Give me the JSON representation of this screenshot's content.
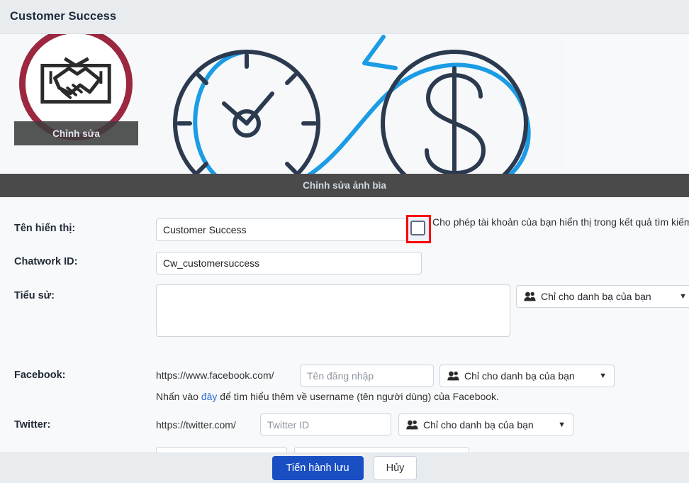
{
  "header": {
    "title": "Customer Success"
  },
  "cover": {
    "edit_label": "Chỉnh sửa ảnh bìa",
    "image_alt": "clock-infinity-dollar-illustration"
  },
  "avatar": {
    "edit_label": "Chỉnh sửa",
    "image_alt": "handshake-icon",
    "ring_color": "#9c2741"
  },
  "form": {
    "display_name": {
      "label": "Tên hiển thị:",
      "value": "Customer Success",
      "placeholder": ""
    },
    "search_visibility": {
      "checkbox_label": "Cho phép tài khoản của bạn hiển thị trong kết quả tìm kiếm",
      "checked": false,
      "highlight_color": "#ff0000"
    },
    "chatwork_id": {
      "label": "Chatwork ID:",
      "value": "Cw_customersuccess",
      "placeholder": ""
    },
    "bio": {
      "label": "Tiểu sử:",
      "value": "",
      "placeholder": "",
      "privacy": "Chỉ cho danh bạ của bạn"
    },
    "facebook": {
      "label": "Facebook:",
      "prefix": "https://www.facebook.com/",
      "value": "",
      "placeholder": "Tên đăng nhập",
      "privacy": "Chỉ cho danh bạ của bạn",
      "hint_before": "Nhấn vào ",
      "hint_link": "đây",
      "hint_after": " để tìm hiểu thêm về username (tên người dùng) của Facebook."
    },
    "twitter": {
      "label": "Twitter:",
      "prefix": "https://twitter.com/",
      "value": "",
      "placeholder": "Twitter ID",
      "privacy": "Chỉ cho danh bạ của bạn"
    },
    "privacy_caret": "▼"
  },
  "footer": {
    "save_label": "Tiến hành lưu",
    "cancel_label": "Hủy",
    "primary_color": "#1a4fc4"
  }
}
